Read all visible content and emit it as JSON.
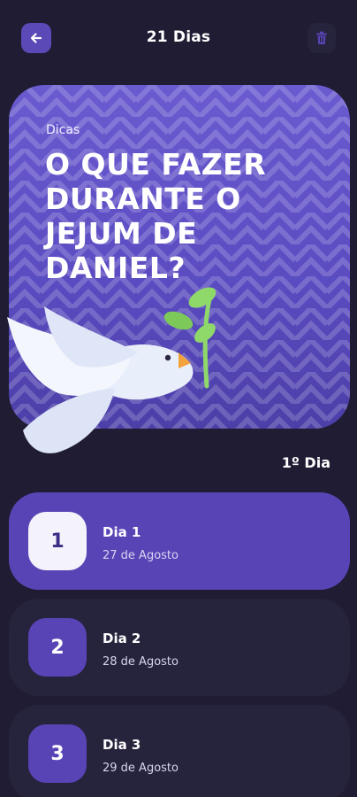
{
  "header": {
    "title": "21 Dias",
    "back_icon": "arrow-left-icon",
    "trash_icon": "trash-icon"
  },
  "hero": {
    "tag": "Dicas",
    "title": "O QUE FAZER DURANTE O JEJUM DE DANIEL?",
    "illustration": "dove-with-olive-branch"
  },
  "progress": {
    "current_day": "1º Dia"
  },
  "days": [
    {
      "number": "1",
      "label": "Dia 1",
      "date": "27 de Agosto",
      "active": true
    },
    {
      "number": "2",
      "label": "Dia 2",
      "date": "28 de Agosto",
      "active": false
    },
    {
      "number": "3",
      "label": "Dia 3",
      "date": "29 de Agosto",
      "active": false
    }
  ],
  "colors": {
    "background": "#1f1c33",
    "accent": "#5944b6",
    "card": "#26233d",
    "hero": "#6a5bd0"
  }
}
